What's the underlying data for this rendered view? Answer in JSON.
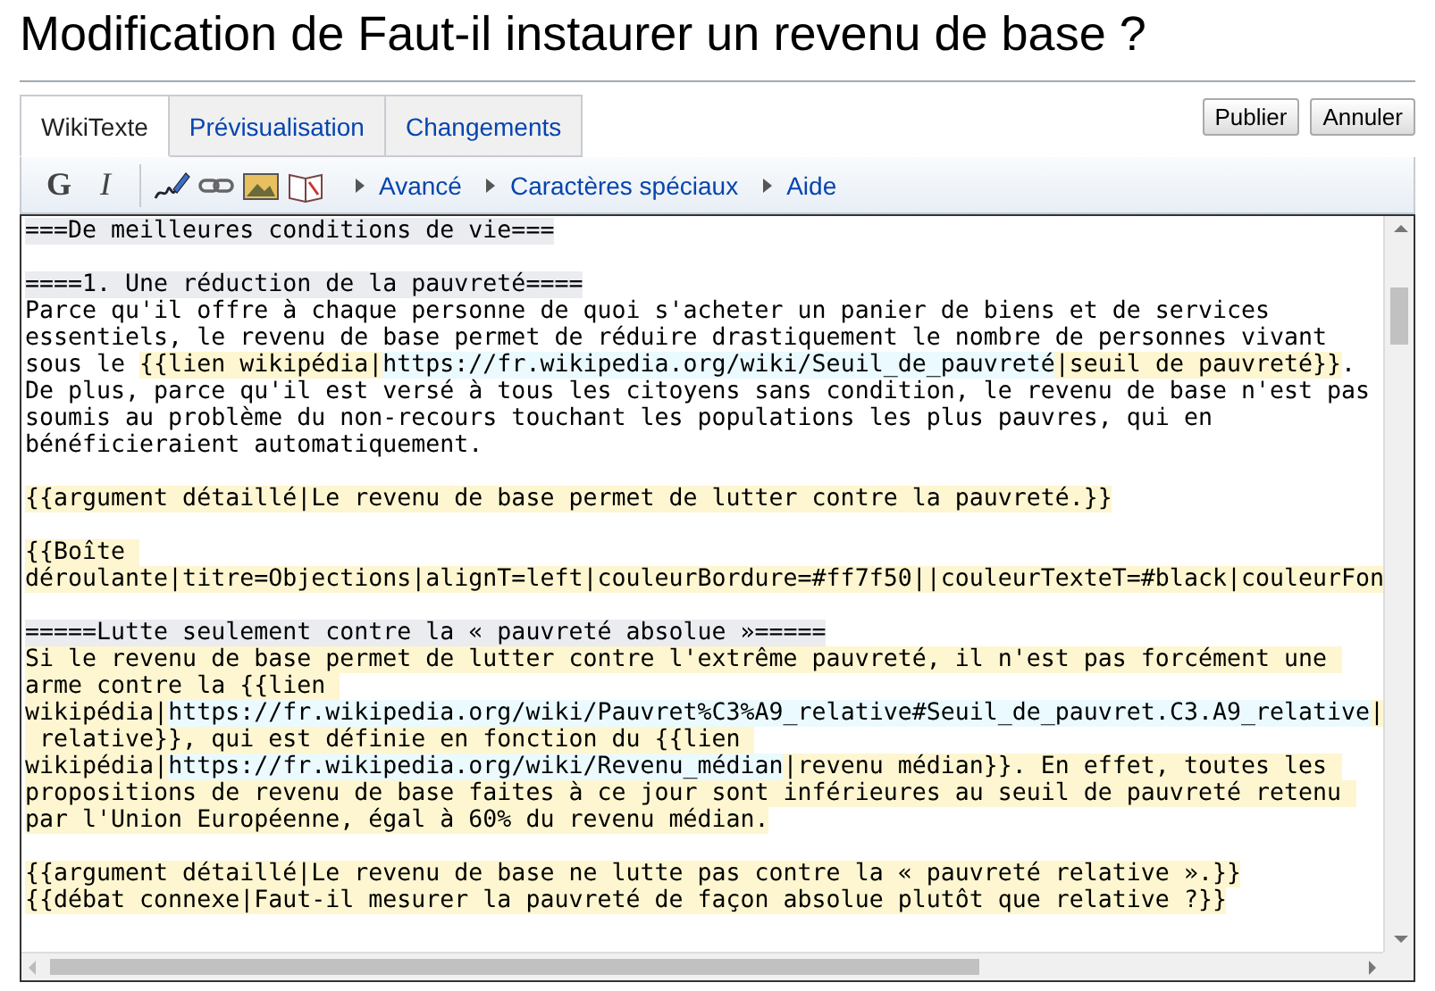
{
  "page_title": "Modification de Faut-il instaurer un revenu de base ?",
  "tabs": [
    {
      "label": "WikiTexte",
      "selected": true
    },
    {
      "label": "Prévisualisation",
      "selected": false
    },
    {
      "label": "Changements",
      "selected": false
    }
  ],
  "buttons": [
    "Publier",
    "Annuler"
  ],
  "toolbar": {
    "format_buttons": [
      {
        "kind": "bold",
        "label": "G"
      },
      {
        "kind": "italic",
        "label": "I"
      }
    ],
    "menus": [
      "Avancé",
      "Caractères spéciaux",
      "Aide"
    ]
  },
  "editor_lines": [
    {
      "kind": "text",
      "segments": [
        {
          "kind": "heading",
          "text": "===De meilleures conditions de vie==="
        }
      ]
    },
    {
      "kind": "blank"
    },
    {
      "kind": "text",
      "segments": [
        {
          "kind": "heading",
          "text": "====1. Une réduction de la pauvreté===="
        }
      ]
    },
    {
      "kind": "text",
      "segments": [
        {
          "kind": "plain",
          "text": "Parce qu'il offre à chaque personne de quoi s'acheter un panier de biens et de services"
        }
      ]
    },
    {
      "kind": "text",
      "segments": [
        {
          "kind": "plain",
          "text": "essentiels, le revenu de base permet de réduire drastiquement le nombre de personnes vivant"
        }
      ]
    },
    {
      "kind": "text",
      "segments": [
        {
          "kind": "plain",
          "text": "sous le "
        },
        {
          "kind": "template",
          "text": "{{lien wikipédia|"
        },
        {
          "kind": "url",
          "text": "https://fr.wikipedia.org/wiki/Seuil_de_pauvreté"
        },
        {
          "kind": "template",
          "text": "|seuil de pauvreté}}"
        },
        {
          "kind": "plain",
          "text": "."
        }
      ]
    },
    {
      "kind": "text",
      "segments": [
        {
          "kind": "plain",
          "text": "De plus, parce qu'il est versé à tous les citoyens sans condition, le revenu de base n'est pas"
        }
      ]
    },
    {
      "kind": "text",
      "segments": [
        {
          "kind": "plain",
          "text": "soumis au problème du non-recours touchant les populations les plus pauvres, qui en"
        }
      ]
    },
    {
      "kind": "text",
      "segments": [
        {
          "kind": "plain",
          "text": "bénéficieraient automatiquement."
        }
      ]
    },
    {
      "kind": "blank"
    },
    {
      "kind": "text",
      "segments": [
        {
          "kind": "template",
          "text": "{{argument détaillé|Le revenu de base permet de lutter contre la pauvreté.}}"
        }
      ]
    },
    {
      "kind": "blank"
    },
    {
      "kind": "text",
      "segments": [
        {
          "kind": "template",
          "text": "{{Boîte "
        }
      ]
    },
    {
      "kind": "text",
      "segments": [
        {
          "kind": "template",
          "text": "déroulante|titre=Objections|alignT=left|couleurBordure=#ff7f50||couleurTexteT=#black|couleurFon"
        }
      ]
    },
    {
      "kind": "blank"
    },
    {
      "kind": "text",
      "segments": [
        {
          "kind": "heading",
          "text": "=====Lutte seulement contre la « pauvreté absolue »====="
        }
      ]
    },
    {
      "kind": "text",
      "segments": [
        {
          "kind": "template",
          "text": "Si le revenu de base permet de lutter contre l'extrême pauvreté, il n'est pas forcément une "
        }
      ]
    },
    {
      "kind": "text",
      "segments": [
        {
          "kind": "template",
          "text": "arme contre la {{lien "
        }
      ]
    },
    {
      "kind": "text",
      "segments": [
        {
          "kind": "template",
          "text": "wikipédia|"
        },
        {
          "kind": "url",
          "text": "https://fr.wikipedia.org/wiki/Pauvret%C3%A9_relative#Seuil_de_pauvret.C3.A9_relative"
        },
        {
          "kind": "template",
          "text": "|"
        }
      ]
    },
    {
      "kind": "text",
      "segments": [
        {
          "kind": "template",
          "text": " relative}}, qui est définie en fonction du {{lien "
        }
      ]
    },
    {
      "kind": "text",
      "segments": [
        {
          "kind": "template",
          "text": "wikipédia|"
        },
        {
          "kind": "url",
          "text": "https://fr.wikipedia.org/wiki/Revenu_médian"
        },
        {
          "kind": "template",
          "text": "|revenu médian}}. En effet, toutes les "
        }
      ]
    },
    {
      "kind": "text",
      "segments": [
        {
          "kind": "template",
          "text": "propositions de revenu de base faites à ce jour sont inférieures au seuil de pauvreté retenu "
        }
      ]
    },
    {
      "kind": "text",
      "segments": [
        {
          "kind": "template",
          "text": "par l'Union Européenne, égal à 60% du revenu médian."
        }
      ]
    },
    {
      "kind": "blank"
    },
    {
      "kind": "text",
      "segments": [
        {
          "kind": "template",
          "text": "{{argument détaillé|Le revenu de base ne lutte pas contre la « pauvreté relative ».}}"
        }
      ]
    },
    {
      "kind": "text",
      "segments": [
        {
          "kind": "template",
          "text": "{{débat connexe|Faut-il mesurer la pauvreté de façon absolue plutôt que relative ?}}"
        }
      ]
    }
  ]
}
